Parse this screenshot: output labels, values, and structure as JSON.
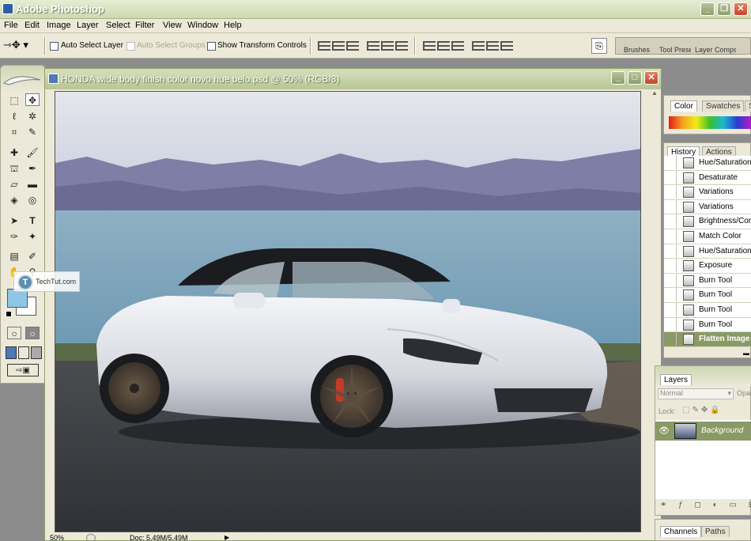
{
  "app": {
    "title": "Adobe Photoshop"
  },
  "menu": [
    "File",
    "Edit",
    "Image",
    "Layer",
    "Select",
    "Filter",
    "View",
    "Window",
    "Help"
  ],
  "options": {
    "auto_select_layer": "Auto Select Layer",
    "auto_select_groups": "Auto Select Groups",
    "show_transform_controls": "Show Transform Controls"
  },
  "well_tabs": [
    "Brushes",
    "Tool Presets",
    "Layer Comps"
  ],
  "document": {
    "title": "HONDA wide body finish color novo hue belo.psd @ 50% (RGB/8)",
    "zoom": "50%",
    "doc_size": "Doc: 5.49M/5.49M"
  },
  "watermark": "TechTut.com",
  "color_panel": {
    "tabs": [
      "Color",
      "Swatches",
      "S"
    ]
  },
  "history_panel": {
    "tabs": [
      "History",
      "Actions"
    ],
    "items": [
      "Hue/Saturation",
      "Desaturate",
      "Variations",
      "Variations",
      "Brightness/Contrast",
      "Match Color",
      "Hue/Saturation",
      "Exposure",
      "Burn Tool",
      "Burn Tool",
      "Burn Tool",
      "Burn Tool",
      "Flatten Image"
    ],
    "selected_index": 12
  },
  "layers_panel": {
    "tab": "Layers",
    "blend_mode": "Normal",
    "opacity_label": "Opacity:",
    "lock_label": "Lock:",
    "layer_name": "Background"
  },
  "channels_panel": {
    "tabs": [
      "Channels",
      "Paths"
    ]
  },
  "colors": {
    "xp_olive": "#b8c594",
    "selected_history": "#8a9a66",
    "foreground": "#8ec7e6",
    "background": "#ffffff"
  }
}
